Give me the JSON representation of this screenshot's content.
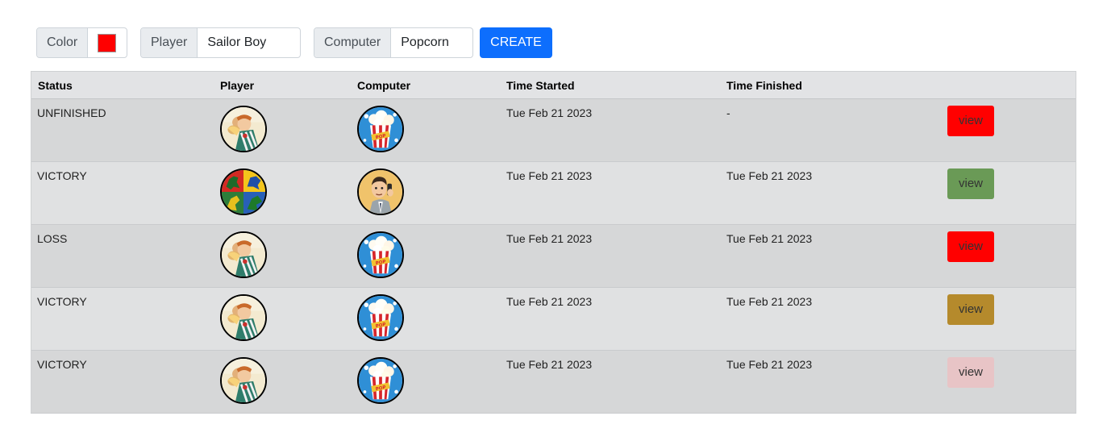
{
  "toolbar": {
    "color_label": "Color",
    "color_value": "#ff0000",
    "player_label": "Player",
    "player_value": "Sailor Boy",
    "computer_label": "Computer",
    "computer_value": "Popcorn",
    "create_label": "CREATE",
    "create_color": "#0d6efd"
  },
  "table": {
    "headers": {
      "status": "Status",
      "player": "Player",
      "computer": "Computer",
      "time_started": "Time Started",
      "time_finished": "Time Finished"
    },
    "rows": [
      {
        "status": "UNFINISHED",
        "player_icon": "sailor-boy-avatar",
        "computer_icon": "popcorn-avatar",
        "time_started": "Tue Feb 21 2023",
        "time_finished": "-",
        "view_label": "view",
        "view_color": "#ff0000",
        "bg": "#d6d7d8"
      },
      {
        "status": "VICTORY",
        "player_icon": "dinosaur-quadrant-avatar",
        "computer_icon": "phone-man-avatar",
        "time_started": "Tue Feb 21 2023",
        "time_finished": "Tue Feb 21 2023",
        "view_label": "view",
        "view_color": "#6a9a56",
        "bg": "#e0e1e2"
      },
      {
        "status": "LOSS",
        "player_icon": "sailor-boy-avatar",
        "computer_icon": "popcorn-avatar",
        "time_started": "Tue Feb 21 2023",
        "time_finished": "Tue Feb 21 2023",
        "view_label": "view",
        "view_color": "#ff0000",
        "bg": "#d6d7d8"
      },
      {
        "status": "VICTORY",
        "player_icon": "sailor-boy-avatar",
        "computer_icon": "popcorn-avatar",
        "time_started": "Tue Feb 21 2023",
        "time_finished": "Tue Feb 21 2023",
        "view_label": "view",
        "view_color": "#b58a2c",
        "bg": "#e0e1e2"
      },
      {
        "status": "VICTORY",
        "player_icon": "sailor-boy-avatar",
        "computer_icon": "popcorn-avatar",
        "time_started": "Tue Feb 21 2023",
        "time_finished": "Tue Feb 21 2023",
        "view_label": "view",
        "view_color": "#e8c4c6",
        "bg": "#d6d7d8"
      }
    ],
    "header_bg": "#e2e3e5"
  }
}
